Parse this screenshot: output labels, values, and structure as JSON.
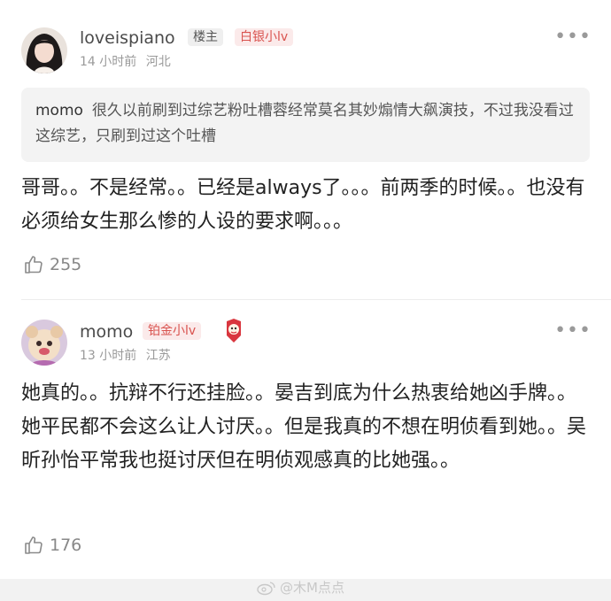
{
  "comments": [
    {
      "username": "loveispiano",
      "owner_badge": "楼主",
      "level_badge": "白银小lv",
      "time": "14 小时前",
      "location": "河北",
      "quote": {
        "name": "momo",
        "text": "很久以前刷到过综艺粉吐槽蓉经常莫名其妙煽情大飙演技，不过我没看过这综艺，只刷到过这个吐槽"
      },
      "body": "哥哥。。不是经常。。已经是always了。。。前两季的时候。。也没有必须给女生那么惨的人设的要求啊。。。",
      "likes": "255"
    },
    {
      "username": "momo",
      "level_badge": "铂金小lv",
      "time": "13 小时前",
      "location": "江苏",
      "body": "她真的。。抗辩不行还挂脸。。晏吉到底为什么热衷给她凶手牌。。她平民都不会这么让人讨厌。。但是我真的不想在明侦看到她。。吴昕孙怡平常我也挺讨厌但在明侦观感真的比她强。。",
      "likes": "176"
    }
  ],
  "more_label": "•••",
  "watermark": "@木M点点"
}
